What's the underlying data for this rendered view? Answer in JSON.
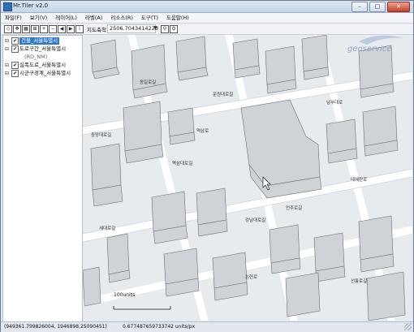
{
  "window": {
    "title": "Mr.Tiler v2.0",
    "minimize": "–",
    "maximize": "□",
    "close": "✕"
  },
  "menu": [
    "파일(F)",
    "보기(V)",
    "레이어(L)",
    "라벨(A)",
    "리소스(R)",
    "도구(T)",
    "도움말(H)"
  ],
  "toolbar": {
    "scale_label": "지도축척",
    "scale_value": "2506.7043414223",
    "scale_dropdown": "▼"
  },
  "layers": [
    {
      "label": "건물_서울특별시",
      "checked": true,
      "selected": true,
      "toggle": "⊟"
    },
    {
      "label": "도로구간_서울특별시",
      "checked": true,
      "selected": false,
      "toggle": "⊟"
    },
    {
      "label": "(RD_NM)",
      "checked": false,
      "selected": false,
      "toggle": ""
    },
    {
      "label": "실폭도로_서울특별시",
      "checked": true,
      "selected": false,
      "toggle": "⊟"
    },
    {
      "label": "시군구경계_서울특별시",
      "checked": true,
      "selected": false,
      "toggle": "⊟"
    }
  ],
  "map": {
    "watermark": "geoservice",
    "scalebar_label": "100units",
    "road_labels": [
      "중앙대로길",
      "동일로길",
      "문원대로길",
      "남부대로",
      "세대로길",
      "역삼대로길",
      "강남대로길",
      "테헤란로",
      "역삼로",
      "언주로길",
      "논현로",
      "선릉로길"
    ]
  },
  "status": {
    "coords": "(949361.799826004, 1946898.25090451)",
    "resolution": "0.677487659733742 units/px"
  }
}
